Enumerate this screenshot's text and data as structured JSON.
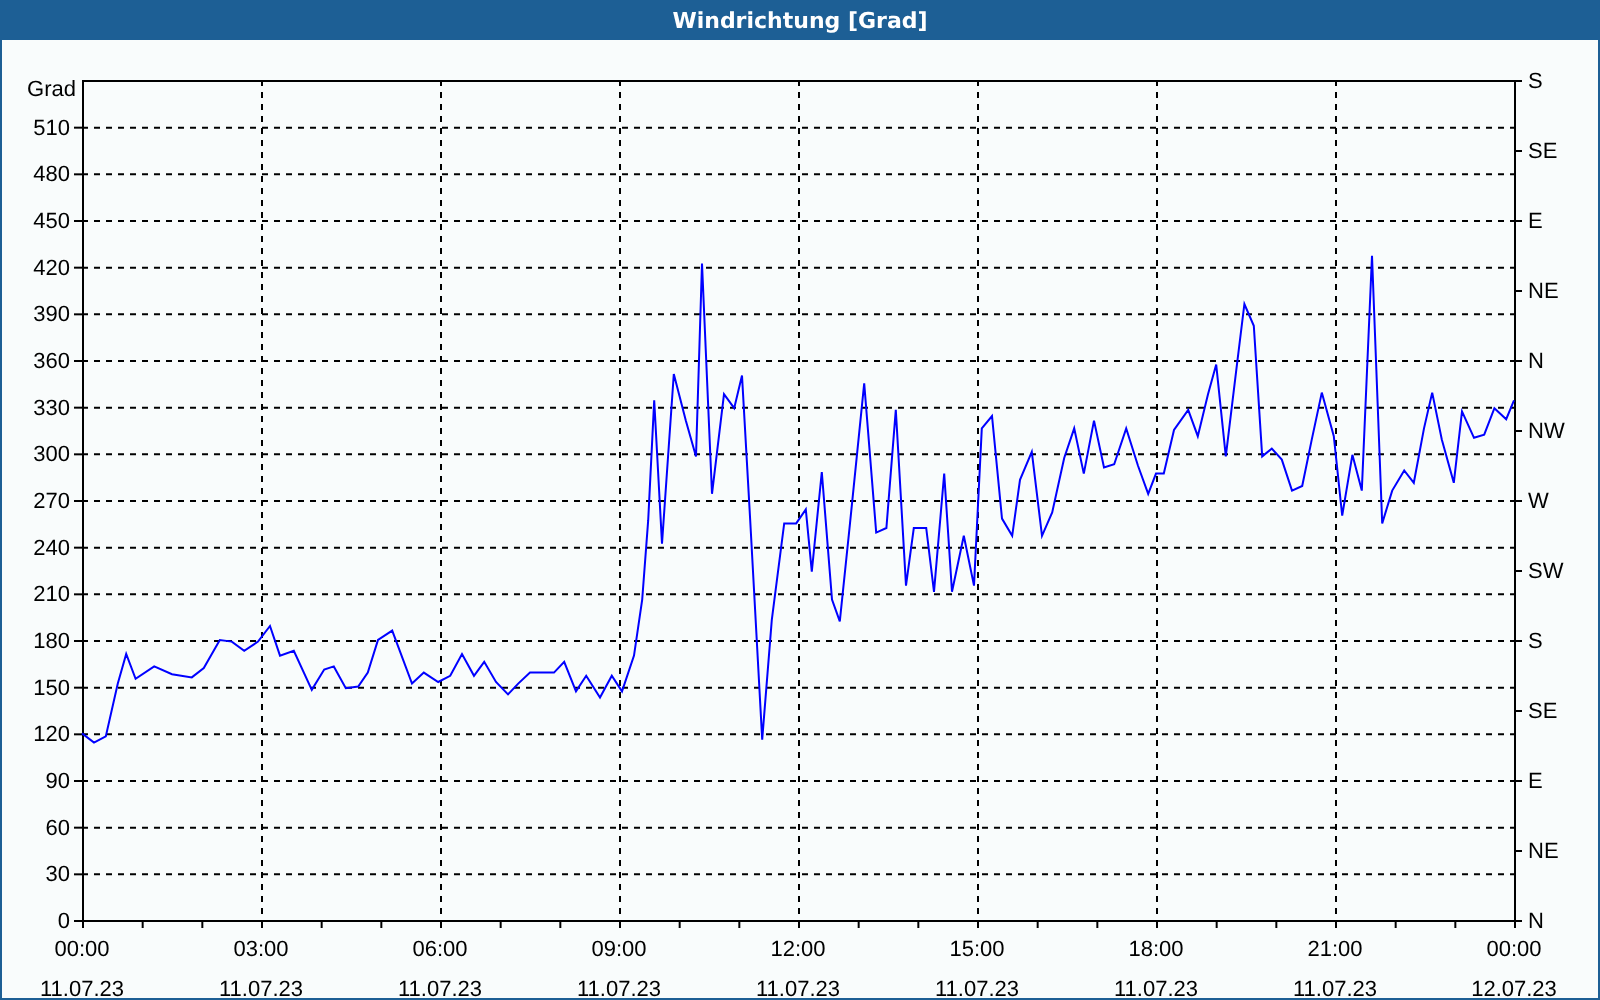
{
  "window": {
    "title": "Windrichtung [Grad]"
  },
  "chart": {
    "chart_data": {
      "type": "line",
      "ylabel": "Grad",
      "xlim": [
        0,
        24
      ],
      "ylim": [
        0,
        540
      ],
      "xticks": [
        {
          "value": 0,
          "label": "00:00"
        },
        {
          "value": 3,
          "label": "03:00"
        },
        {
          "value": 6,
          "label": "06:00"
        },
        {
          "value": 9,
          "label": "09:00"
        },
        {
          "value": 12,
          "label": "12:00"
        },
        {
          "value": 15,
          "label": "15:00"
        },
        {
          "value": 18,
          "label": "18:00"
        },
        {
          "value": 21,
          "label": "21:00"
        },
        {
          "value": 24,
          "label": "00:00"
        }
      ],
      "yticks": [
        0,
        30,
        60,
        90,
        120,
        150,
        180,
        210,
        240,
        270,
        300,
        330,
        360,
        390,
        420,
        450,
        480,
        510
      ],
      "grid": true,
      "x": [
        0,
        0.2,
        0.4,
        0.6,
        0.74,
        0.9,
        1.21,
        1.51,
        1.84,
        2.04,
        2.31,
        2.51,
        2.72,
        2.95,
        3.15,
        3.32,
        3.55,
        3.85,
        4.06,
        4.22,
        4.42,
        4.63,
        4.79,
        4.96,
        5.2,
        5.53,
        5.73,
        5.97,
        6.17,
        6.37,
        6.57,
        6.74,
        6.94,
        7.14,
        7.31,
        7.51,
        7.71,
        7.91,
        8.08,
        8.28,
        8.45,
        8.68,
        8.88,
        9.05,
        9.25,
        9.39,
        9.49,
        9.59,
        9.72,
        9.92,
        10.12,
        10.29,
        10.39,
        10.56,
        10.76,
        10.93,
        11.06,
        11.2,
        11.4,
        11.56,
        11.77,
        11.97,
        12.13,
        12.23,
        12.4,
        12.57,
        12.7,
        12.87,
        13.11,
        13.31,
        13.48,
        13.64,
        13.81,
        13.94,
        14.15,
        14.28,
        14.45,
        14.58,
        14.78,
        14.95,
        15.08,
        15.25,
        15.42,
        15.59,
        15.72,
        15.92,
        16.09,
        16.26,
        16.46,
        16.63,
        16.79,
        16.96,
        17.13,
        17.3,
        17.5,
        17.7,
        17.87,
        18.0,
        18.13,
        18.3,
        18.54,
        18.7,
        18.87,
        19.01,
        19.17,
        19.34,
        19.48,
        19.64,
        19.78,
        19.94,
        20.11,
        20.28,
        20.45,
        20.61,
        20.78,
        20.98,
        21.12,
        21.29,
        21.45,
        21.62,
        21.79,
        21.96,
        22.16,
        22.32,
        22.49,
        22.63,
        22.79,
        22.99,
        23.13,
        23.33,
        23.5,
        23.67,
        23.87,
        24.0
      ],
      "series": [
        {
          "color": "#0000ff",
          "values": [
            120,
            114,
            118,
            152,
            171,
            155,
            163,
            158,
            156,
            162,
            180,
            179,
            173,
            179,
            189,
            170,
            173,
            148,
            161,
            163,
            149,
            150,
            159,
            180,
            186,
            152,
            159,
            153,
            157,
            171,
            157,
            166,
            153,
            145,
            152,
            159,
            159,
            159,
            166,
            147,
            157,
            143,
            157,
            147,
            170,
            206,
            257,
            334,
            242,
            351,
            321,
            298,
            422,
            274,
            338,
            329,
            350,
            257,
            116,
            193,
            255,
            255,
            264,
            224,
            288,
            206,
            192,
            255,
            345,
            249,
            252,
            328,
            215,
            252,
            252,
            211,
            287,
            211,
            247,
            215,
            316,
            324,
            258,
            247,
            283,
            301,
            247,
            262,
            297,
            316,
            287,
            321,
            291,
            293,
            316,
            292,
            274,
            287,
            287,
            315,
            328,
            311,
            338,
            357,
            298,
            352,
            396,
            382,
            298,
            303,
            296,
            276,
            279,
            309,
            339,
            311,
            260,
            299,
            276,
            427,
            255,
            276,
            289,
            281,
            316,
            339,
            309,
            281,
            327,
            310,
            312,
            329,
            322,
            334
          ]
        }
      ]
    },
    "date_labels": [
      "11.07.23",
      "11.07.23",
      "11.07.23",
      "11.07.23",
      "11.07.23",
      "11.07.23",
      "11.07.23",
      "11.07.23",
      "12.07.23"
    ],
    "compass_labels": [
      "S",
      "SE",
      "E",
      "NE",
      "N",
      "NW",
      "W",
      "SW",
      "S",
      "SE",
      "E",
      "NE",
      "N"
    ]
  }
}
